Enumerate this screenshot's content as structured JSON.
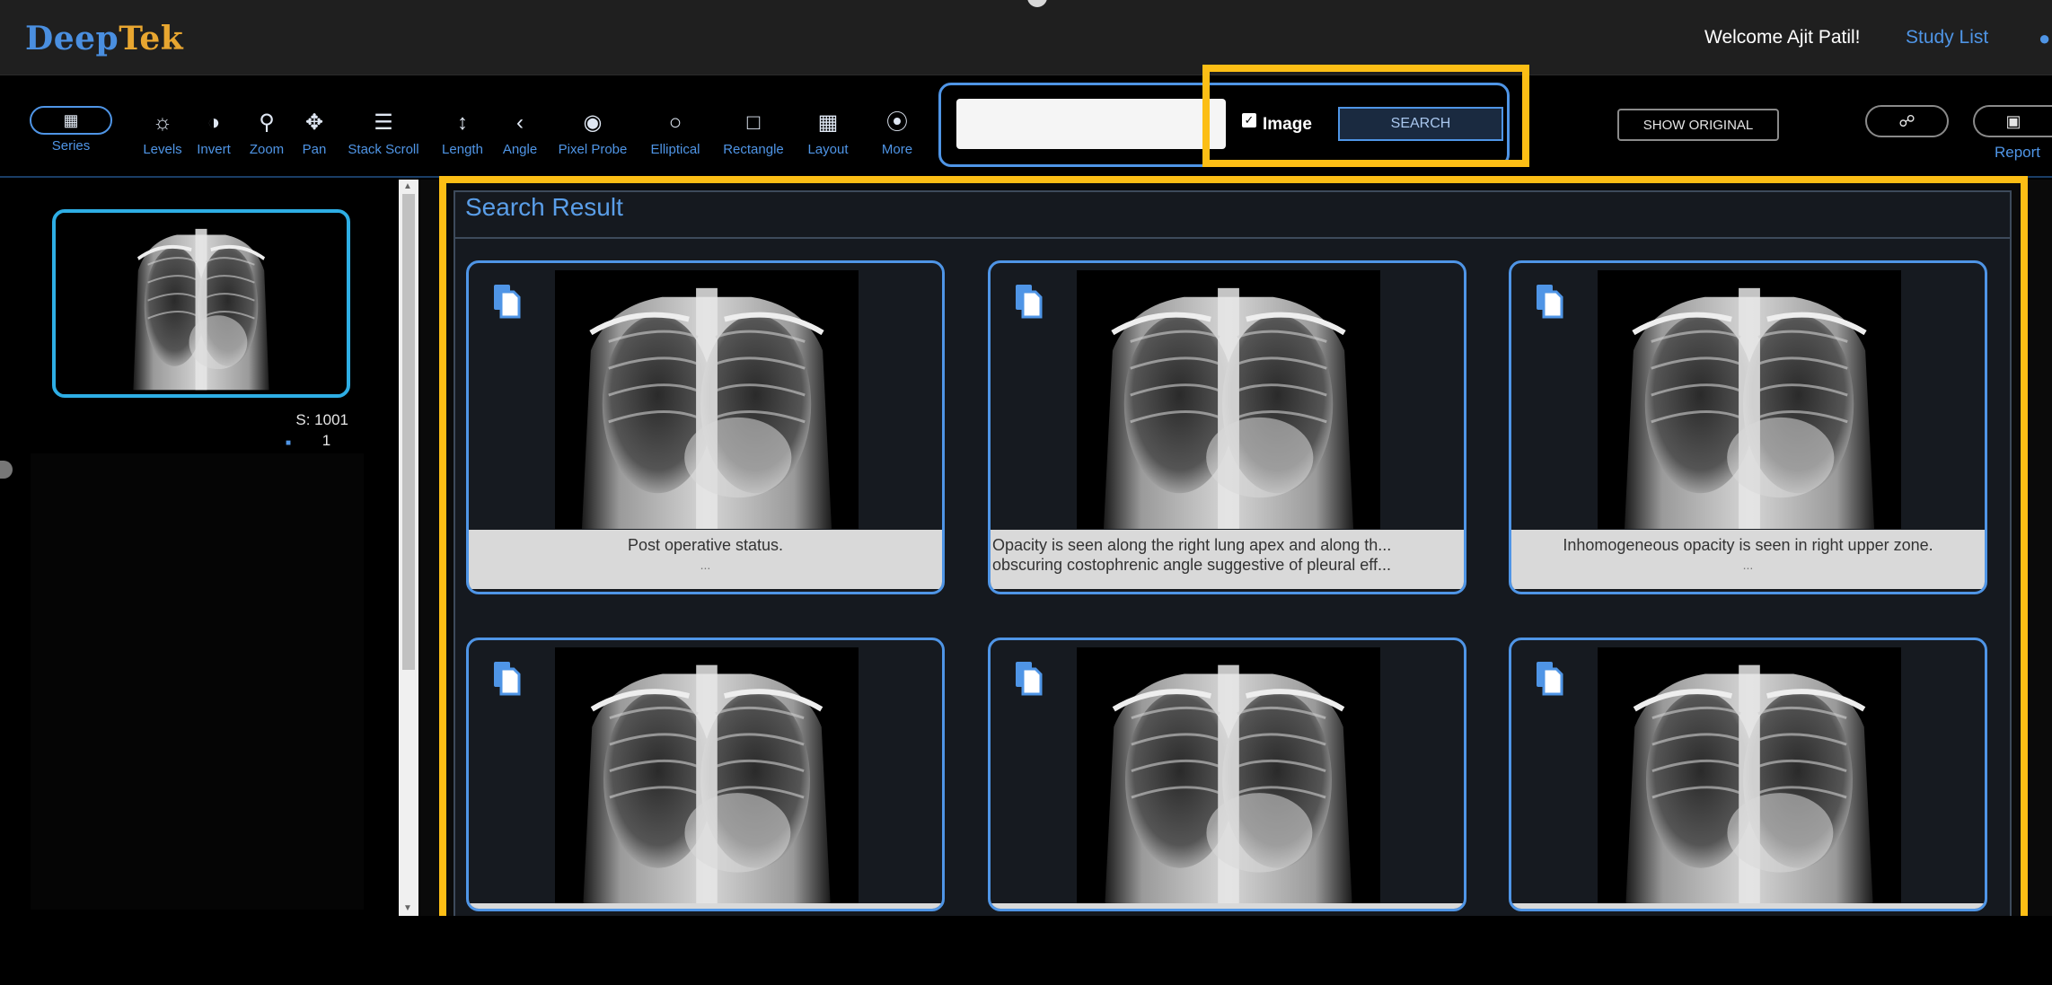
{
  "header": {
    "logo_part1": "Deep",
    "logo_part2": "Tek",
    "welcome": "Welcome Ajit Patil!",
    "study_list": "Study List"
  },
  "toolbar": {
    "tools": [
      {
        "label": "Series",
        "icon": "grid-icon"
      },
      {
        "label": "Levels",
        "icon": "sun-icon"
      },
      {
        "label": "Invert",
        "icon": "contrast-icon"
      },
      {
        "label": "Zoom",
        "icon": "magnifier-icon"
      },
      {
        "label": "Pan",
        "icon": "move-icon"
      },
      {
        "label": "Stack Scroll",
        "icon": "bars-icon"
      },
      {
        "label": "Length",
        "icon": "ruler-icon"
      },
      {
        "label": "Angle",
        "icon": "angle-icon"
      },
      {
        "label": "Pixel Probe",
        "icon": "probe-icon"
      },
      {
        "label": "Elliptical",
        "icon": "circle-icon"
      },
      {
        "label": "Rectangle",
        "icon": "square-icon"
      },
      {
        "label": "Layout",
        "icon": "layout-icon"
      },
      {
        "label": "More",
        "icon": "chevron-circle-icon"
      }
    ],
    "search_input_value": "",
    "image_checkbox_label": "Image",
    "image_checked": true,
    "search_button": "SEARCH",
    "show_original": "SHOW ORIGINAL",
    "report_label": "Report"
  },
  "series_panel": {
    "series_number": "S: 1001",
    "image_count": "1"
  },
  "search_result": {
    "title": "Search Result",
    "cards": [
      {
        "caption_line1": "Post operative status.",
        "caption_line2": "",
        "more": "..."
      },
      {
        "caption_line1": "Opacity is seen along the right lung apex and along th...",
        "caption_line2": "obscuring costophrenic angle suggestive of pleural eff...",
        "more": ""
      },
      {
        "caption_line1": "Inhomogeneous opacity is seen in right upper zone.",
        "caption_line2": "",
        "more": "..."
      },
      {
        "caption_line1": "",
        "caption_line2": "",
        "more": ""
      },
      {
        "caption_line1": "",
        "caption_line2": "",
        "more": ""
      },
      {
        "caption_line1": "",
        "caption_line2": "",
        "more": ""
      }
    ]
  },
  "colors": {
    "accent_blue": "#4f95e6",
    "highlight_yellow": "#fcbe15",
    "logo_orange": "#e8a630"
  }
}
